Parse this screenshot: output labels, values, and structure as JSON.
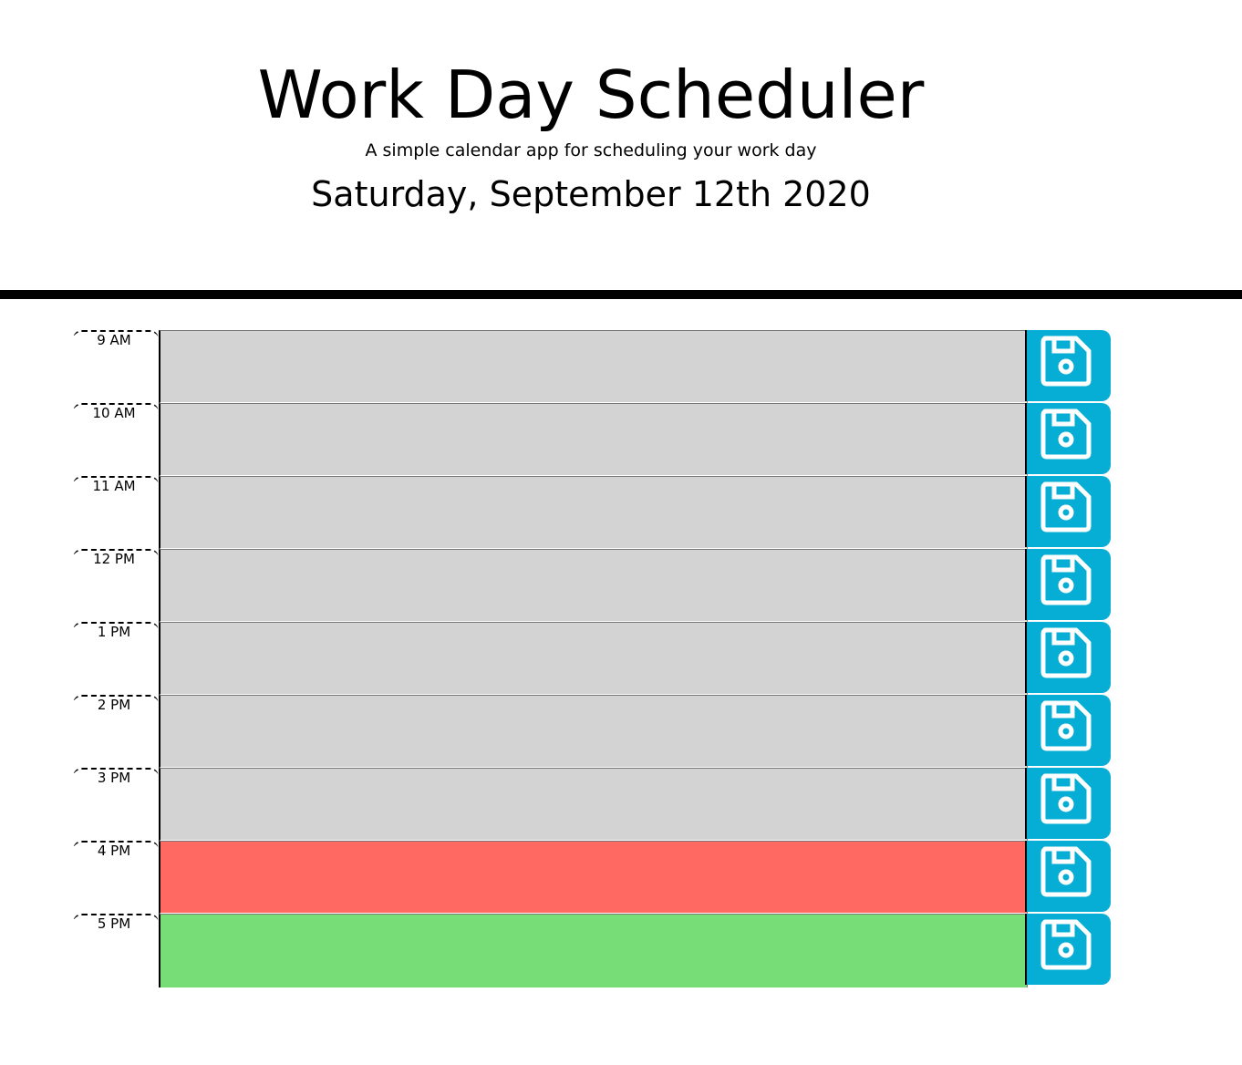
{
  "header": {
    "title": "Work Day Scheduler",
    "lead": "A simple calendar app for scheduling your work day",
    "current_day": "Saturday, September 12th 2020"
  },
  "colors": {
    "past": "#d3d3d3",
    "present": "#ff6961",
    "future": "#77dd77",
    "save_button": "#06aed5",
    "divider": "#000000"
  },
  "schedule": {
    "rows": [
      {
        "hour": "9 AM",
        "status": "past",
        "text": "",
        "save_icon": "save-icon"
      },
      {
        "hour": "10 AM",
        "status": "past",
        "text": "",
        "save_icon": "save-icon"
      },
      {
        "hour": "11 AM",
        "status": "past",
        "text": "",
        "save_icon": "save-icon"
      },
      {
        "hour": "12 PM",
        "status": "past",
        "text": "",
        "save_icon": "save-icon"
      },
      {
        "hour": "1 PM",
        "status": "past",
        "text": "",
        "save_icon": "save-icon"
      },
      {
        "hour": "2 PM",
        "status": "past",
        "text": "",
        "save_icon": "save-icon"
      },
      {
        "hour": "3 PM",
        "status": "past",
        "text": "",
        "save_icon": "save-icon"
      },
      {
        "hour": "4 PM",
        "status": "present",
        "text": "",
        "save_icon": "save-icon"
      },
      {
        "hour": "5 PM",
        "status": "future",
        "text": "",
        "save_icon": "save-icon"
      }
    ]
  }
}
